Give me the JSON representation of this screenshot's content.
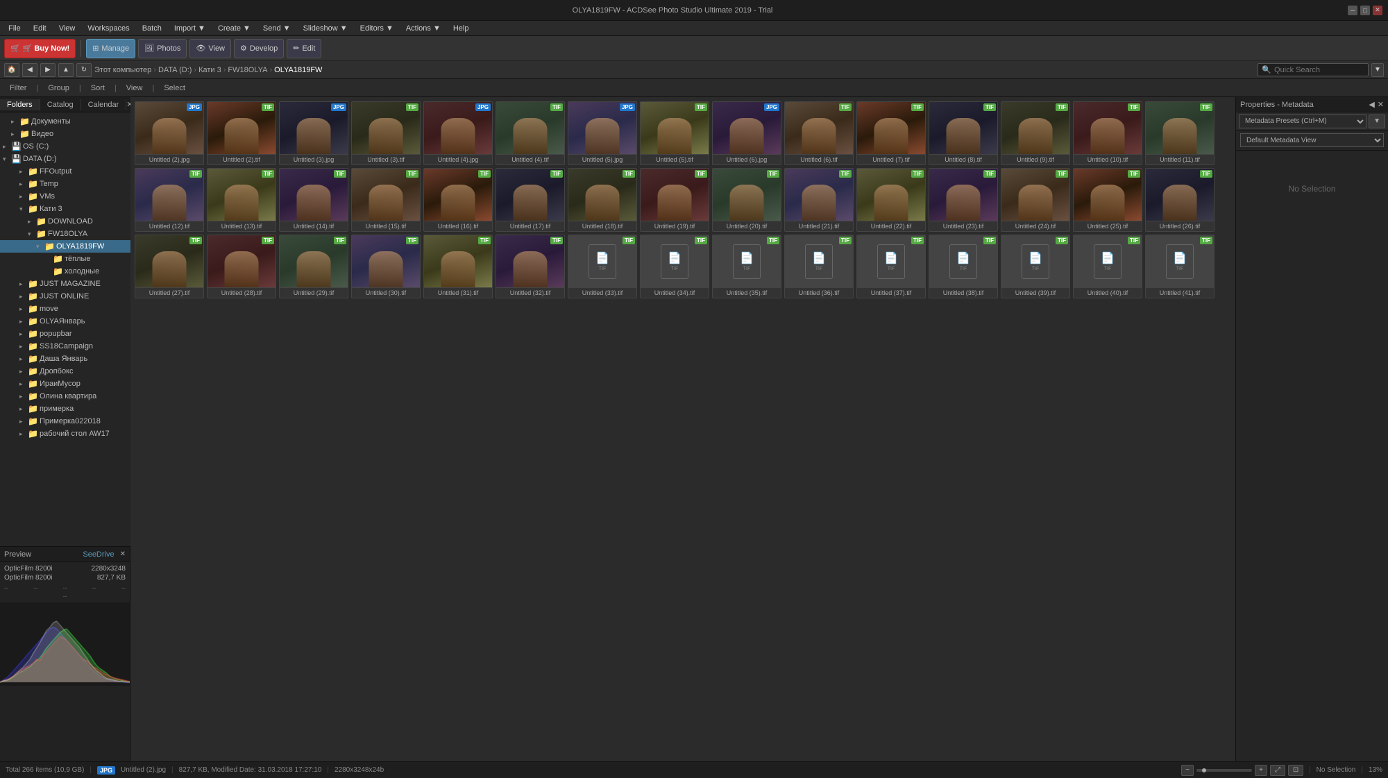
{
  "titlebar": {
    "title": "OLYA1819FW - ACDSee Photo Studio Ultimate 2019 - Trial",
    "minimize": "─",
    "maximize": "□",
    "close": "✕"
  },
  "menubar": {
    "items": [
      "File",
      "Edit",
      "View",
      "Workspaces",
      "Batch",
      "Import ▼",
      "Create ▼",
      "Send ▼",
      "Editors ▼",
      "Actions ▼"
    ]
  },
  "toolbar": {
    "buy_now": "🛒 Buy Now!",
    "manage": "⊞ Manage",
    "photos": "🖼 Photos",
    "view": "👁 View",
    "develop": "⚙ Develop",
    "edit": "✏ Edit"
  },
  "breadcrumb": {
    "parts": [
      "Этот компьютер",
      "DATA (D:)",
      "Кати 3",
      "FW18OLYA",
      "OLYA1819FW"
    ]
  },
  "search": {
    "placeholder": "Quick Search"
  },
  "filterbar": {
    "filter": "Filter",
    "group": "Group",
    "sort": "Sort",
    "view": "View",
    "select": "Select"
  },
  "sidebar": {
    "tabs": [
      "Folders",
      "Catalog",
      "Calendar"
    ],
    "items": [
      {
        "label": "Документы",
        "indent": 1,
        "expanded": false,
        "icon": "📁"
      },
      {
        "label": "Видео",
        "indent": 1,
        "expanded": false,
        "icon": "📁"
      },
      {
        "label": "OS (C:)",
        "indent": 0,
        "expanded": false,
        "icon": "💾"
      },
      {
        "label": "DATA (D:)",
        "indent": 0,
        "expanded": true,
        "icon": "💾"
      },
      {
        "label": "FFOutput",
        "indent": 2,
        "expanded": false,
        "icon": "📁"
      },
      {
        "label": "Temp",
        "indent": 2,
        "expanded": false,
        "icon": "📁"
      },
      {
        "label": "VMs",
        "indent": 2,
        "expanded": false,
        "icon": "📁"
      },
      {
        "label": "Кати 3",
        "indent": 2,
        "expanded": true,
        "icon": "📁"
      },
      {
        "label": "DOWNLOAD",
        "indent": 3,
        "expanded": false,
        "icon": "📁"
      },
      {
        "label": "FW18OLYA",
        "indent": 3,
        "expanded": true,
        "icon": "📁"
      },
      {
        "label": "OLYA1819FW",
        "indent": 4,
        "expanded": true,
        "icon": "📁",
        "selected": true
      },
      {
        "label": "тёплые",
        "indent": 5,
        "expanded": false,
        "icon": "📁"
      },
      {
        "label": "холодные",
        "indent": 5,
        "expanded": false,
        "icon": "📁"
      },
      {
        "label": "JUST MAGAZINE",
        "indent": 2,
        "expanded": false,
        "icon": "📁"
      },
      {
        "label": "JUST ONLINE",
        "indent": 2,
        "expanded": false,
        "icon": "📁"
      },
      {
        "label": "move",
        "indent": 2,
        "expanded": false,
        "icon": "📁"
      },
      {
        "label": "OLYAЯнварь",
        "indent": 2,
        "expanded": false,
        "icon": "📁"
      },
      {
        "label": "popupbar",
        "indent": 2,
        "expanded": false,
        "icon": "📁"
      },
      {
        "label": "SS18Campaign",
        "indent": 2,
        "expanded": false,
        "icon": "📁"
      },
      {
        "label": "Даша Январь",
        "indent": 2,
        "expanded": false,
        "icon": "📁"
      },
      {
        "label": "Дропбокс",
        "indent": 2,
        "expanded": false,
        "icon": "📁"
      },
      {
        "label": "ИраиМусор",
        "indent": 2,
        "expanded": false,
        "icon": "📁"
      },
      {
        "label": "Олина квартира",
        "indent": 2,
        "expanded": false,
        "icon": "📁"
      },
      {
        "label": "примерка",
        "indent": 2,
        "expanded": false,
        "icon": "📁"
      },
      {
        "label": "Примерка022018",
        "indent": 2,
        "expanded": false,
        "icon": "📁"
      },
      {
        "label": "рабочий стол AW17",
        "indent": 2,
        "expanded": false,
        "icon": "📁"
      }
    ]
  },
  "preview": {
    "title": "Preview",
    "seedrive": "SeeDrive",
    "film_name1": "OpticFilm 8200i",
    "film_size1": "2280x3248",
    "film_name2": "OpticFilm 8200i",
    "film_size2": "827,7 KB"
  },
  "right_panel": {
    "title": "Properties - Metadata",
    "preset_label": "Metadata Presets (Ctrl+M)",
    "view_label": "Default Metadata View",
    "no_selection": "No Selection"
  },
  "thumbnails": [
    {
      "name": "Untitled (2).jpg",
      "type": "JPG",
      "row": 0
    },
    {
      "name": "Untitled (2).tif",
      "type": "TIF",
      "row": 0
    },
    {
      "name": "Untitled (3).jpg",
      "type": "JPG",
      "row": 0
    },
    {
      "name": "Untitled (3).tif",
      "type": "TIF",
      "row": 0
    },
    {
      "name": "Untitled (4).jpg",
      "type": "JPG",
      "row": 0
    },
    {
      "name": "Untitled (4).tif",
      "type": "TIF",
      "row": 0
    },
    {
      "name": "Untitled (5).jpg",
      "type": "JPG",
      "row": 0
    },
    {
      "name": "Untitled (5).tif",
      "type": "TIF",
      "row": 0
    },
    {
      "name": "Untitled (6).jpg",
      "type": "JPG",
      "row": 0
    },
    {
      "name": "Untitled (6).tif",
      "type": "TIF",
      "row": 1
    },
    {
      "name": "Untitled (7).tif",
      "type": "TIF",
      "row": 1
    },
    {
      "name": "Untitled (8).tif",
      "type": "TIF",
      "row": 1
    },
    {
      "name": "Untitled (9).tif",
      "type": "TIF",
      "row": 1
    },
    {
      "name": "Untitled (10).tif",
      "type": "TIF",
      "row": 1
    },
    {
      "name": "Untitled (11).tif",
      "type": "TIF",
      "row": 1
    },
    {
      "name": "Untitled (12).tif",
      "type": "TIF",
      "row": 1
    },
    {
      "name": "Untitled (13).tif",
      "type": "TIF",
      "row": 1
    },
    {
      "name": "Untitled (14).tif",
      "type": "TIF",
      "row": 1
    },
    {
      "name": "Untitled (15).tif",
      "type": "TIF",
      "row": 2
    },
    {
      "name": "Untitled (16).tif",
      "type": "TIF",
      "row": 2
    },
    {
      "name": "Untitled (17).tif",
      "type": "TIF",
      "row": 2
    },
    {
      "name": "Untitled (18).tif",
      "type": "TIF",
      "row": 2
    },
    {
      "name": "Untitled (19).tif",
      "type": "TIF",
      "row": 2
    },
    {
      "name": "Untitled (20).tif",
      "type": "TIF",
      "row": 2
    },
    {
      "name": "Untitled (21).tif",
      "type": "TIF",
      "row": 2
    },
    {
      "name": "Untitled (22).tif",
      "type": "TIF",
      "row": 2
    },
    {
      "name": "Untitled (23).tif",
      "type": "TIF",
      "row": 2
    },
    {
      "name": "Untitled (24).tif",
      "type": "TIF",
      "row": 3
    },
    {
      "name": "Untitled (25).tif",
      "type": "TIF",
      "row": 3
    },
    {
      "name": "Untitled (26).tif",
      "type": "TIF",
      "row": 3
    },
    {
      "name": "Untitled (27).tif",
      "type": "TIF",
      "row": 3
    },
    {
      "name": "Untitled (28).tif",
      "type": "TIF",
      "row": 3
    },
    {
      "name": "Untitled (29).tif",
      "type": "TIF",
      "row": 3
    },
    {
      "name": "Untitled (30).tif",
      "type": "TIF",
      "row": 3
    },
    {
      "name": "Untitled (31).tif",
      "type": "TIF",
      "row": 3
    },
    {
      "name": "Untitled (32).tif",
      "type": "TIF",
      "row": 3
    },
    {
      "name": "Untitled (33).tif",
      "type": "TIF",
      "row": 4
    },
    {
      "name": "Untitled (34).tif",
      "type": "TIF",
      "row": 4
    },
    {
      "name": "Untitled (35).tif",
      "type": "TIF",
      "row": 4
    },
    {
      "name": "Untitled (36).tif",
      "type": "TIF",
      "row": 4
    },
    {
      "name": "Untitled (37).tif",
      "type": "TIF",
      "row": 4
    },
    {
      "name": "Untitled (38).tif",
      "type": "TIF",
      "row": 4
    },
    {
      "name": "Untitled (39).tif",
      "type": "TIF",
      "row": 4
    },
    {
      "name": "Untitled (40).tif",
      "type": "TIF",
      "row": 4
    },
    {
      "name": "Untitled (41).tif",
      "type": "TIF",
      "row": 4
    }
  ],
  "statusbar": {
    "total": "Total 266 items (10,9 GB)",
    "file_info": "827,7 KB, Modified Date: 31.03.2018 17:27:10",
    "dimensions": "2280x3248x24b",
    "file_label": "JPG  Untitled (2).jpg",
    "zoom_percent": "13%",
    "no_selection": "No Selection"
  },
  "colors": {
    "accent": "#4a9abb",
    "bg_dark": "#1e1e1e",
    "bg_mid": "#2b2b2b",
    "bg_light": "#333",
    "selected": "#3a6a8a",
    "badge_jpg": "#2277cc",
    "badge_tif": "#55aa44"
  }
}
